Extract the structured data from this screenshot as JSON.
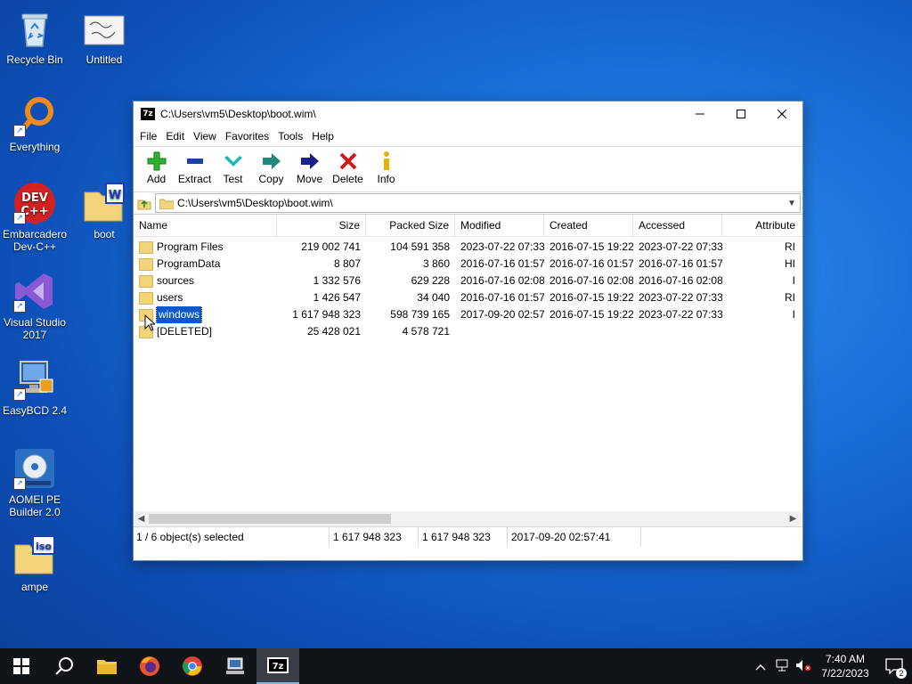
{
  "desktop": {
    "icons": [
      {
        "label": "Recycle Bin"
      },
      {
        "label": "Untitled"
      },
      {
        "label": "Everything"
      },
      {
        "label": "Embarcadero Dev-C++"
      },
      {
        "label": "boot"
      },
      {
        "label": "Visual Studio 2017"
      },
      {
        "label": "EasyBCD 2.4"
      },
      {
        "label": "AOMEI PE Builder 2.0"
      },
      {
        "label": "ampe"
      }
    ]
  },
  "window": {
    "title": "C:\\Users\\vm5\\Desktop\\boot.wim\\",
    "app_icon": "7z",
    "menu": [
      "File",
      "Edit",
      "View",
      "Favorites",
      "Tools",
      "Help"
    ],
    "toolbar": [
      {
        "label": "Add",
        "icon": "plus-icon",
        "color": "#2db52d"
      },
      {
        "label": "Extract",
        "icon": "minus-icon",
        "color": "#1b3fb0"
      },
      {
        "label": "Test",
        "icon": "check-icon",
        "color": "#1fb5b5"
      },
      {
        "label": "Copy",
        "icon": "copy-arrow-icon",
        "color": "#1f8a7a"
      },
      {
        "label": "Move",
        "icon": "move-arrow-icon",
        "color": "#1a1f8a"
      },
      {
        "label": "Delete",
        "icon": "delete-x-icon",
        "color": "#d11a1a"
      },
      {
        "label": "Info",
        "icon": "info-icon",
        "color": "#e0b400"
      }
    ],
    "address": "C:\\Users\\vm5\\Desktop\\boot.wim\\",
    "columns": [
      "Name",
      "Size",
      "Packed Size",
      "Modified",
      "Created",
      "Accessed",
      "Attribute"
    ],
    "rows": [
      {
        "name": "Program Files",
        "size": "219 002 741",
        "packed": "104 591 358",
        "modified": "2023-07-22 07:33",
        "created": "2016-07-15 19:22",
        "accessed": "2023-07-22 07:33",
        "attr": "RI"
      },
      {
        "name": "ProgramData",
        "size": "8 807",
        "packed": "3 860",
        "modified": "2016-07-16 01:57",
        "created": "2016-07-16 01:57",
        "accessed": "2016-07-16 01:57",
        "attr": "HI"
      },
      {
        "name": "sources",
        "size": "1 332 576",
        "packed": "629 228",
        "modified": "2016-07-16 02:08",
        "created": "2016-07-16 02:08",
        "accessed": "2016-07-16 02:08",
        "attr": "I"
      },
      {
        "name": "users",
        "size": "1 426 547",
        "packed": "34 040",
        "modified": "2016-07-16 01:57",
        "created": "2016-07-15 19:22",
        "accessed": "2023-07-22 07:33",
        "attr": "RI"
      },
      {
        "name": "windows",
        "size": "1 617 948 323",
        "packed": "598 739 165",
        "modified": "2017-09-20 02:57",
        "created": "2016-07-15 19:22",
        "accessed": "2023-07-22 07:33",
        "attr": "I"
      },
      {
        "name": "[DELETED]",
        "size": "25 428 021",
        "packed": "4 578 721",
        "modified": "",
        "created": "",
        "accessed": "",
        "attr": ""
      }
    ],
    "selected_row": "windows",
    "status": {
      "selection": "1 / 6 object(s) selected",
      "size": "1 617 948 323",
      "packed": "1 617 948 323",
      "modified": "2017-09-20 02:57:41"
    }
  },
  "taskbar": {
    "apps": [
      "start-icon",
      "search-icon",
      "file-explorer-icon",
      "firefox-icon",
      "chrome-icon",
      "network-pc-icon",
      "7zip-icon"
    ],
    "clock_time": "7:40 AM",
    "clock_date": "7/22/2023",
    "notification_count": "2"
  },
  "colors": {
    "selection": "#0a58c9",
    "taskbar": "#101418",
    "folder": "#f2d47a"
  }
}
